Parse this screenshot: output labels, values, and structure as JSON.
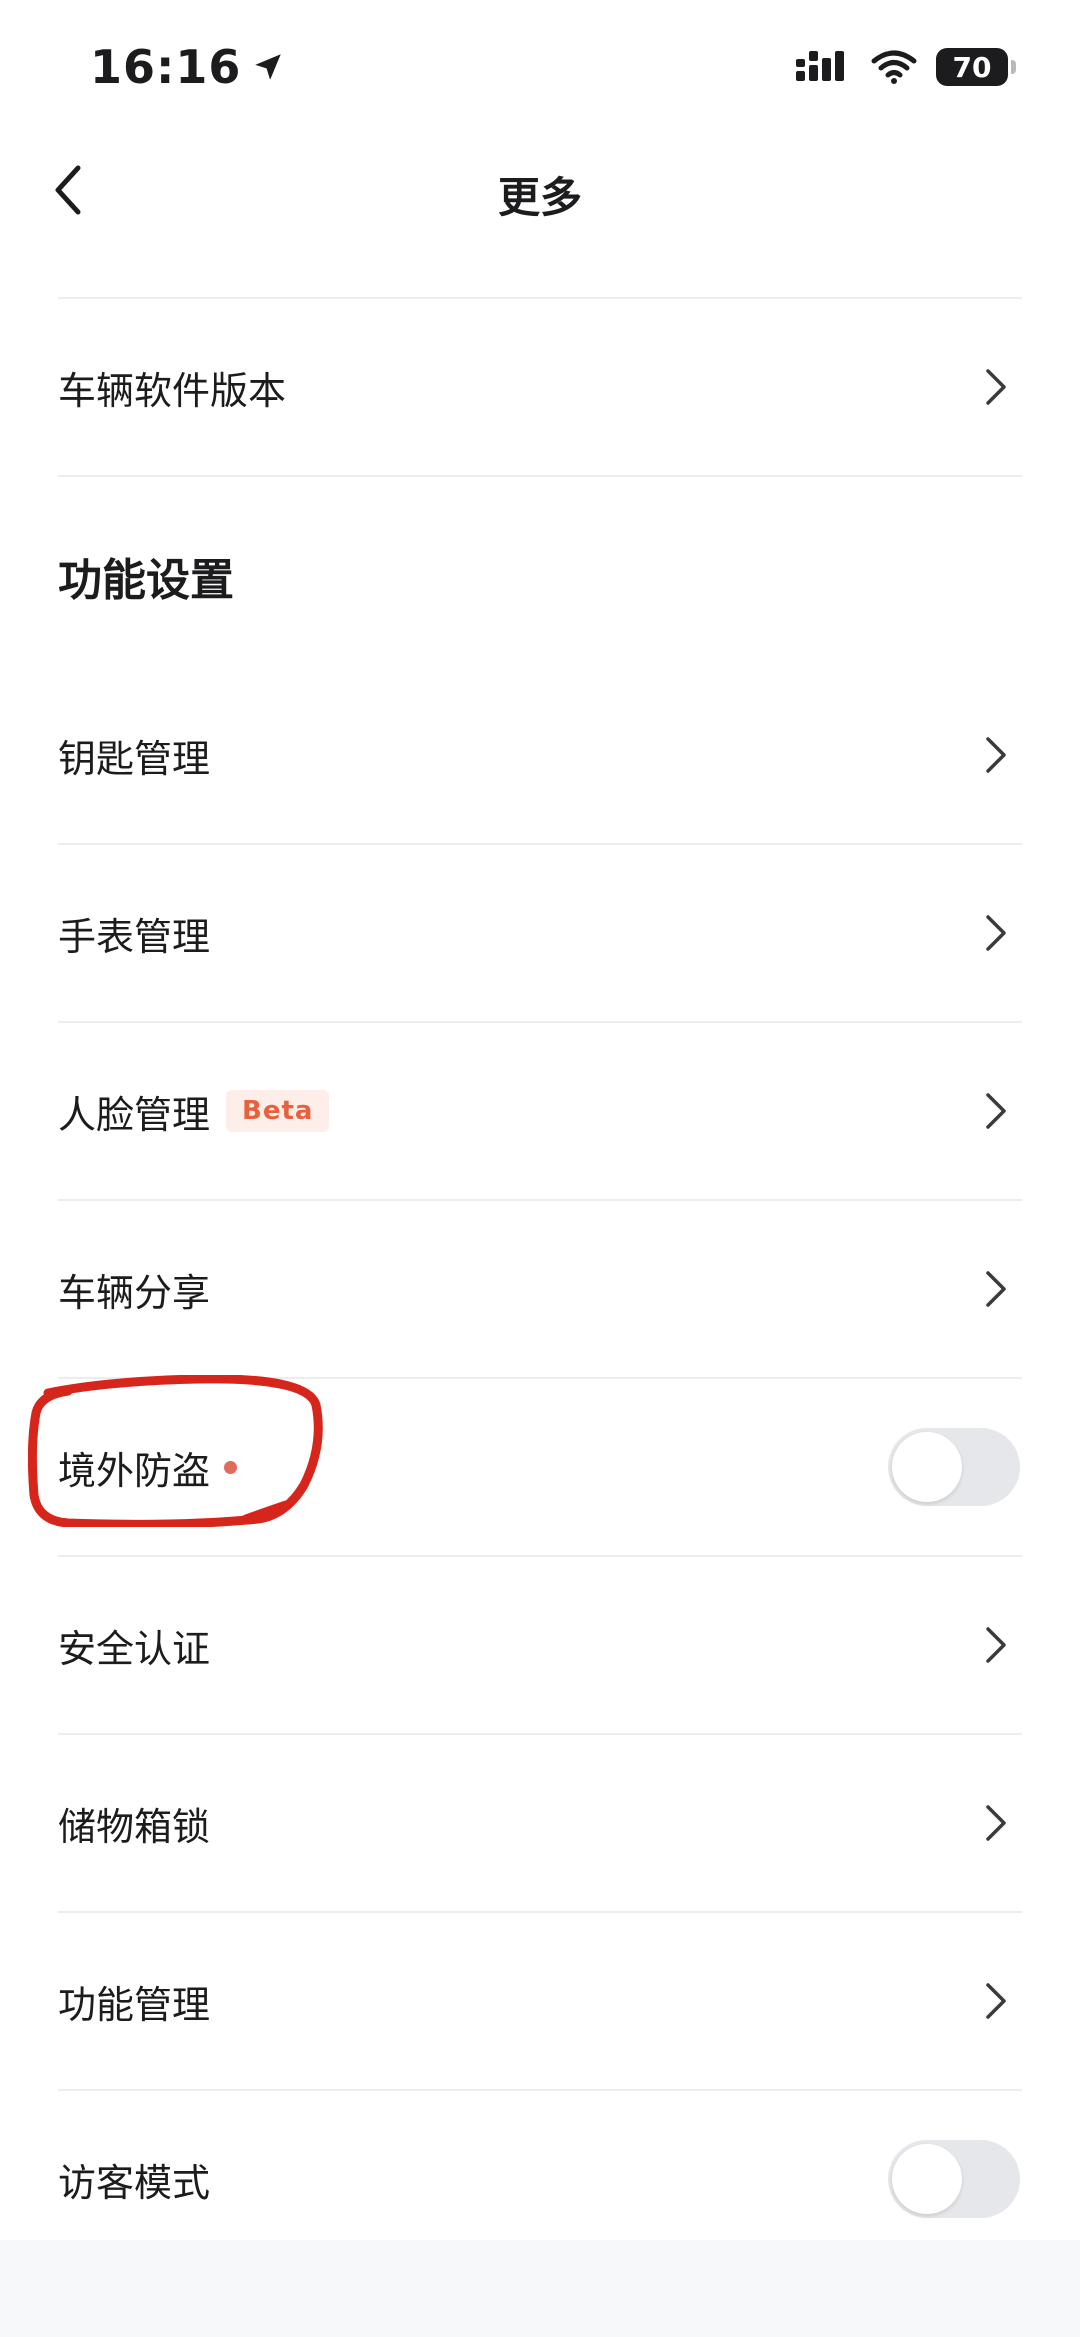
{
  "status_bar": {
    "time": "16:16",
    "battery": "70"
  },
  "nav": {
    "title": "更多"
  },
  "rows_top": [
    {
      "label": "车辆软件版本",
      "control": "chevron"
    }
  ],
  "section": {
    "title": "功能设置"
  },
  "rows": [
    {
      "label": "钥匙管理",
      "control": "chevron"
    },
    {
      "label": "手表管理",
      "control": "chevron"
    },
    {
      "label": "人脸管理",
      "badge": "Beta",
      "control": "chevron"
    },
    {
      "label": "车辆分享",
      "control": "chevron"
    },
    {
      "label": "境外防盗",
      "dot": true,
      "control": "toggle",
      "toggle_on": false
    },
    {
      "label": "安全认证",
      "control": "chevron"
    },
    {
      "label": "储物箱锁",
      "control": "chevron"
    },
    {
      "label": "功能管理",
      "control": "chevron"
    },
    {
      "label": "访客模式",
      "control": "toggle",
      "toggle_on": false
    }
  ],
  "colors": {
    "badge_text": "#e8613d",
    "badge_bg": "#fdeee9",
    "annotation": "#d6261c",
    "toggle_off": "#e6e7ea"
  }
}
